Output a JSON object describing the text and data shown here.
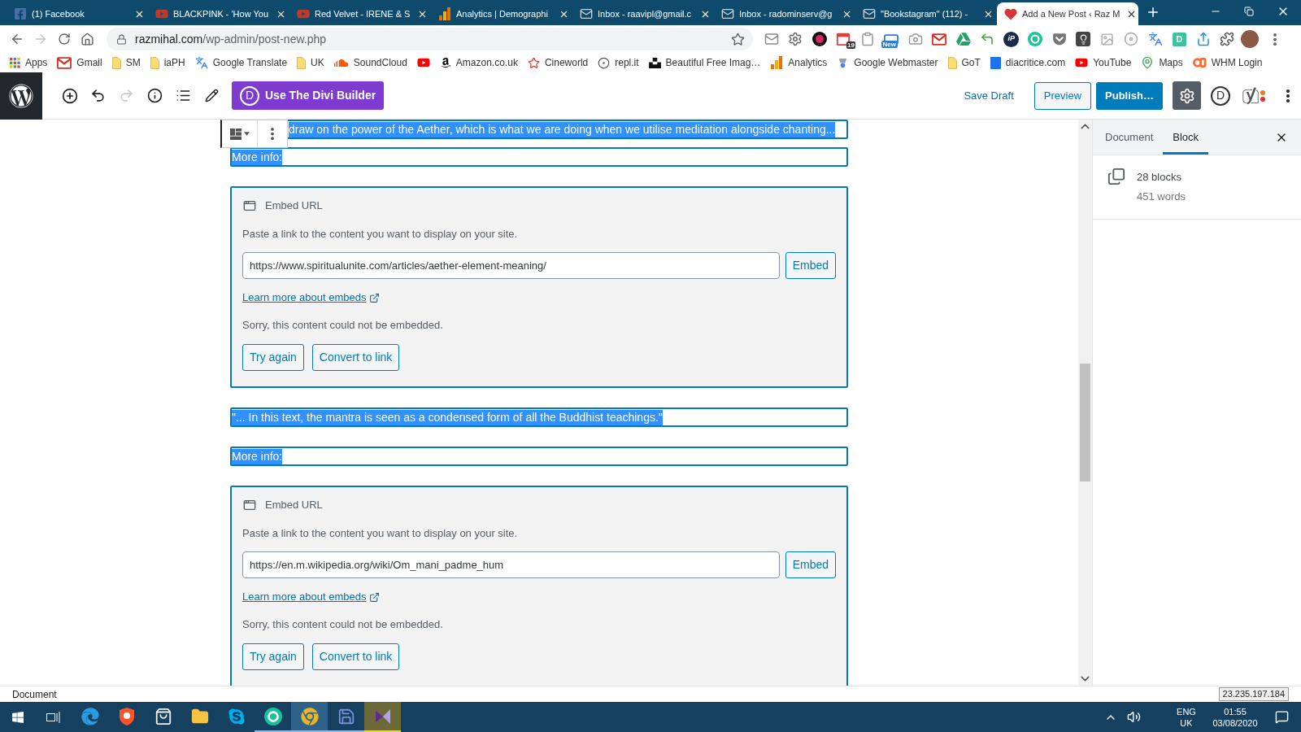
{
  "browser": {
    "tabs": [
      {
        "kind": "facebook",
        "title": "(1) Facebook",
        "selected": false
      },
      {
        "kind": "youtube",
        "title": "BLACKPINK - 'How You",
        "selected": false
      },
      {
        "kind": "youtube",
        "title": "Red Velvet - IRENE & S",
        "selected": false
      },
      {
        "kind": "analytics",
        "title": "Analytics | Demographi",
        "selected": false
      },
      {
        "kind": "mail",
        "title": "Inbox - raavipl@gmail.c",
        "selected": false
      },
      {
        "kind": "mail",
        "title": "Inbox - radominserv@g",
        "selected": false
      },
      {
        "kind": "mail",
        "title": "\"Bookstagram\" (112) -",
        "selected": false
      },
      {
        "kind": "heart",
        "title": "Add a New Post ‹ Raz M",
        "selected": true
      }
    ],
    "nav": {
      "back_disabled": false,
      "forward_disabled": true
    },
    "address": {
      "host": "razmihal.com",
      "path": "/wp-admin/post-new.php"
    },
    "extensions": [
      {
        "kind": "mail"
      },
      {
        "kind": "gear"
      },
      {
        "kind": "record"
      },
      {
        "kind": "calendar",
        "text": "19"
      },
      {
        "kind": "clipboard"
      },
      {
        "kind": "window",
        "text": "New"
      },
      {
        "kind": "camera"
      },
      {
        "kind": "gmail"
      },
      {
        "kind": "drive"
      },
      {
        "kind": "arrow"
      },
      {
        "kind": "circle",
        "text": "iP"
      },
      {
        "kind": "ring"
      },
      {
        "kind": "pocket"
      },
      {
        "kind": "bulb"
      },
      {
        "kind": "image"
      },
      {
        "kind": "disc"
      },
      {
        "kind": "translate"
      },
      {
        "kind": "tile",
        "text": "D"
      },
      {
        "kind": "share"
      },
      {
        "kind": "puzzle"
      }
    ],
    "bookmarks": [
      {
        "kind": "apps",
        "label": "Apps"
      },
      {
        "kind": "gmail",
        "label": "Gmail"
      },
      {
        "kind": "folder",
        "label": "SM"
      },
      {
        "kind": "folder",
        "label": "iaPH"
      },
      {
        "kind": "translate",
        "label": "Google Translate"
      },
      {
        "kind": "folder",
        "label": "UK"
      },
      {
        "kind": "soundcloud",
        "label": "SoundCloud"
      },
      {
        "kind": "youtube"
      },
      {
        "kind": "amazon",
        "label": "Amazon.co.uk"
      },
      {
        "kind": "star",
        "label": "Cineworld"
      },
      {
        "kind": "swirl",
        "label": "repl.it"
      },
      {
        "kind": "blocks",
        "label": "Beautiful Free Imag…"
      },
      {
        "kind": "analytics",
        "label": "Analytics"
      },
      {
        "kind": "webmaster",
        "label": "Google Webmaster"
      },
      {
        "kind": "folder",
        "label": "GoT"
      },
      {
        "kind": "tile",
        "label": "diacritice.com"
      },
      {
        "kind": "youtube",
        "label": "YouTube"
      },
      {
        "kind": "maps",
        "label": "Maps"
      },
      {
        "kind": "whm",
        "label": "WHM Login"
      }
    ]
  },
  "wp_toolbar": {
    "undo_disabled": false,
    "redo_disabled": true,
    "divi_logo": "D",
    "divi_label": "Use The Divi Builder",
    "save_draft": "Save Draft",
    "preview": "Preview",
    "publish": "Publish…",
    "settings_pressed": true,
    "divi_icon": "D"
  },
  "editor": {
    "blocks": [
      {
        "kind": "paragraph",
        "text": "draw on the power of the Aether, which is what we are doing when we utilise meditation alongside chanting...",
        "selected": true
      },
      {
        "kind": "paragraph",
        "text": "More info:",
        "selected": true
      },
      {
        "kind": "embed",
        "selected": true,
        "title": "Embed URL",
        "instructions": "Paste a link to the content you want to display on your site.",
        "url": "https://www.spiritualunite.com/articles/aether-element-meaning/",
        "embed_button": "Embed",
        "learn_more": "Learn more about embeds",
        "error": "Sorry, this content could not be embedded.",
        "buttons": [
          "Try again",
          "Convert to link"
        ]
      },
      {
        "kind": "paragraph",
        "text": "\"... In this text, the mantra is seen as a condensed form of all the Buddhist teachings.\"",
        "selected": true
      },
      {
        "kind": "paragraph",
        "text": "More info:",
        "selected": true
      },
      {
        "kind": "embed",
        "selected": true,
        "title": "Embed URL",
        "instructions": "Paste a link to the content you want to display on your site.",
        "url": "https://en.m.wikipedia.org/wiki/Om_mani_padme_hum",
        "embed_button": "Embed",
        "learn_more": "Learn more about embeds",
        "error": "Sorry, this content could not be embedded.",
        "buttons": [
          "Try again",
          "Convert to link"
        ]
      }
    ]
  },
  "sidebar": {
    "tabs": [
      {
        "label": "Document",
        "selected": false
      },
      {
        "label": "Block",
        "selected": true
      }
    ],
    "block_count": "28 blocks",
    "word_count": "451 words"
  },
  "status_bar": {
    "breadcrumb": "Document",
    "tooltip": "23.235.197.184"
  },
  "taskbar": {
    "apps": [
      {
        "kind": "edge",
        "open": false,
        "selected": false,
        "attention": false
      },
      {
        "kind": "shield",
        "open": false,
        "selected": false,
        "attention": false
      },
      {
        "kind": "store",
        "open": false,
        "selected": false,
        "attention": false
      },
      {
        "kind": "folder",
        "open": false,
        "selected": false,
        "attention": false
      },
      {
        "kind": "skype",
        "open": false,
        "selected": false,
        "attention": false
      },
      {
        "kind": "ring",
        "open": true,
        "selected": false,
        "attention": false
      },
      {
        "kind": "chrome",
        "open": true,
        "selected": true,
        "attention": false
      },
      {
        "kind": "disk",
        "open": true,
        "selected": false,
        "attention": false
      },
      {
        "kind": "studio",
        "open": true,
        "selected": false,
        "attention": true
      }
    ],
    "language": "ENG",
    "region": "UK",
    "time": "01:55",
    "date": "03/08/2020"
  }
}
